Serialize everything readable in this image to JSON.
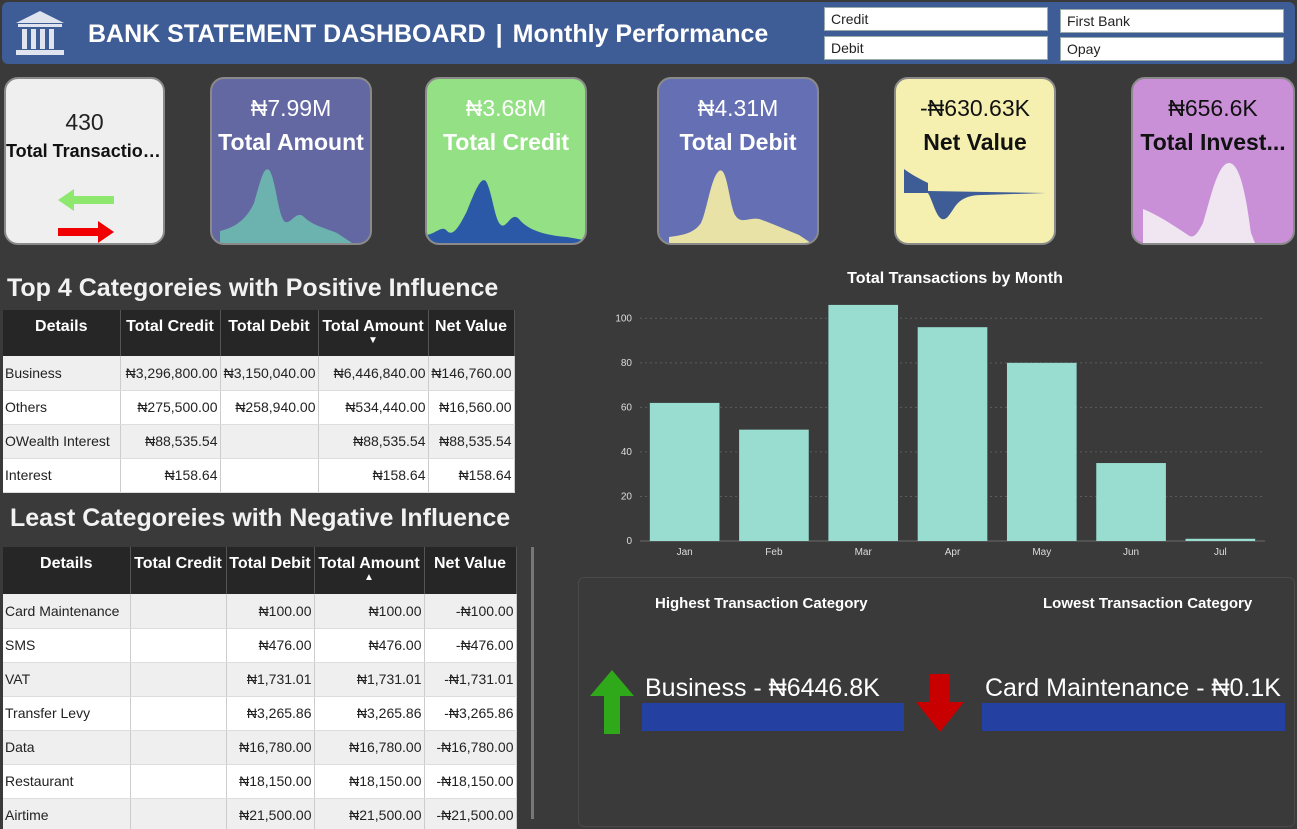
{
  "header": {
    "title": "BANK STATEMENT DASHBOARD",
    "separator": "|",
    "subtitle": "Monthly Performance",
    "slicers": [
      "Credit",
      "Debit",
      "First Bank",
      "Opay"
    ]
  },
  "kpis": [
    {
      "value": "430",
      "label": "Total Transactions"
    },
    {
      "value": "₦7.99M",
      "label": "Total Amount"
    },
    {
      "value": "₦3.68M",
      "label": "Total Credit"
    },
    {
      "value": "₦4.31M",
      "label": "Total Debit"
    },
    {
      "value": "-₦630.63K",
      "label": "Net Value"
    },
    {
      "value": "₦656.6K",
      "label": "Total Invest..."
    }
  ],
  "positive_table": {
    "title": "Top 4 Categoreies with Positive Influence",
    "columns": [
      "Details",
      "Total Credit",
      "Total Debit",
      "Total Amount",
      "Net Value"
    ],
    "rows": [
      [
        "Business",
        "₦3,296,800.00",
        "₦3,150,040.00",
        "₦6,446,840.00",
        "₦146,760.00"
      ],
      [
        "Others",
        "₦275,500.00",
        "₦258,940.00",
        "₦534,440.00",
        "₦16,560.00"
      ],
      [
        "OWealth Interest",
        "₦88,535.54",
        "",
        "₦88,535.54",
        "₦88,535.54"
      ],
      [
        "Interest",
        "₦158.64",
        "",
        "₦158.64",
        "₦158.64"
      ]
    ]
  },
  "negative_table": {
    "title": "Least Categoreies with Negative Influence",
    "columns": [
      "Details",
      "Total Credit",
      "Total Debit",
      "Total Amount",
      "Net Value"
    ],
    "rows": [
      [
        "Card Maintenance",
        "",
        "₦100.00",
        "₦100.00",
        "-₦100.00"
      ],
      [
        "SMS",
        "",
        "₦476.00",
        "₦476.00",
        "-₦476.00"
      ],
      [
        "VAT",
        "",
        "₦1,731.01",
        "₦1,731.01",
        "-₦1,731.01"
      ],
      [
        "Transfer Levy",
        "",
        "₦3,265.86",
        "₦3,265.86",
        "-₦3,265.86"
      ],
      [
        "Data",
        "",
        "₦16,780.00",
        "₦16,780.00",
        "-₦16,780.00"
      ],
      [
        "Restaurant",
        "",
        "₦18,150.00",
        "₦18,150.00",
        "-₦18,150.00"
      ],
      [
        "Airtime",
        "",
        "₦21,500.00",
        "₦21,500.00",
        "-₦21,500.00"
      ]
    ]
  },
  "chart_data": {
    "type": "bar",
    "title": "Total Transactions by Month",
    "categories": [
      "Jan",
      "Feb",
      "Mar",
      "Apr",
      "May",
      "Jun",
      "Jul"
    ],
    "values": [
      62,
      50,
      106,
      96,
      80,
      35,
      1
    ],
    "ylim": [
      0,
      110
    ],
    "yticks": [
      0,
      20,
      40,
      60,
      80,
      100
    ],
    "grid": true,
    "color": "#98ddd0"
  },
  "extremes": {
    "highest_label": "Highest Transaction Category",
    "lowest_label": "Lowest Transaction Category",
    "highest_value": "Business - ₦6446.8K",
    "lowest_value": "Card Maintenance - ₦0.1K"
  },
  "colors": {
    "header": "#3e5c96",
    "card_total_transactions": "#efefef",
    "card_total_amount": "#6468a2",
    "card_total_credit": "#94e084",
    "card_total_debit": "#6570b4",
    "card_net_value": "#f5f0b0",
    "card_total_invest": "#c990d8",
    "bar": "#98ddd0",
    "arrow_up": "#2fa81a",
    "arrow_down": "#c80000"
  }
}
